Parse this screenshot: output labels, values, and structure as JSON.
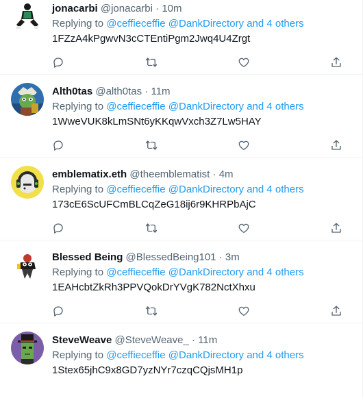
{
  "tweets": [
    {
      "name": "jonacarbi",
      "handle": "@jonacarbi",
      "time": "10m",
      "replying_prefix": "Replying to",
      "mentions": "@ceffieceffie @DankDirectory and 4 others",
      "text": "1FZzA4kPgwvN3cCTEntiPgm2Jwq4U4Zrgt"
    },
    {
      "name": "Alth0tas",
      "handle": "@alth0tas",
      "time": "11m",
      "replying_prefix": "Replying to",
      "mentions": "@ceffieceffie @DankDirectory and 4 others",
      "text": "1WweVUK8kLmSNt6yKKqwVxch3Z7Lw5HAY"
    },
    {
      "name": "emblematix.eth",
      "handle": "@theemblematist",
      "time": "4m",
      "replying_prefix": "Replying to",
      "mentions": "@ceffieceffie @DankDirectory and 4 others",
      "text": "173cE6ScUFCmBLCqZeG18ij6r9KHRPbAjC"
    },
    {
      "name": "Blessed Being",
      "handle": "@BlessedBeing101",
      "time": "3m",
      "replying_prefix": "Replying to",
      "mentions": "@ceffieceffie @DankDirectory and 4 others",
      "text": "1EAHcbtZkRh3PPVQokDrYVgK782NctXhxu"
    },
    {
      "name": "SteveWeave",
      "handle": "@SteveWeave_",
      "time": "11m",
      "replying_prefix": "Replying to",
      "mentions": "@ceffieceffie @DankDirectory and 4 others",
      "text": "1Stex65jhC9x8GD7yzNYr7czqCQjsMH1p"
    }
  ],
  "separator": "·",
  "icons": [
    "reply-icon",
    "retweet-icon",
    "like-icon",
    "share-icon"
  ],
  "colors": {
    "link": "#1d9bf0",
    "secondary": "#536471",
    "primary": "#0f1419",
    "divider": "#eff3f4"
  }
}
